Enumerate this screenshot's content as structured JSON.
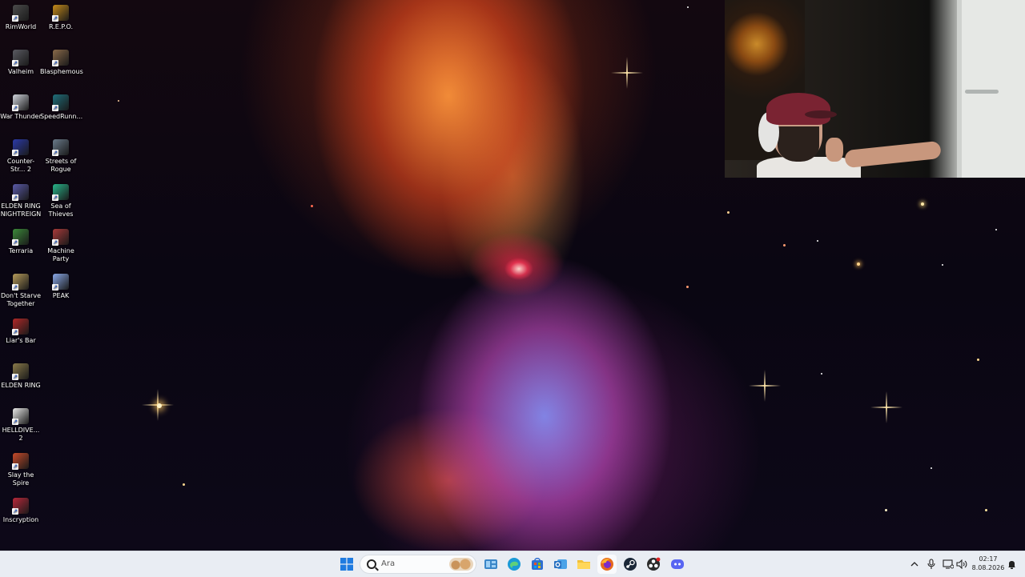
{
  "desktop": {
    "icons": [
      {
        "label": "RimWorld",
        "color": "#4b4b4b"
      },
      {
        "label": "R.E.P.O.",
        "color": "#c58a1a"
      },
      {
        "label": "Valheim",
        "color": "#5a5a62"
      },
      {
        "label": "Blasphemous",
        "color": "#8a6a4a"
      },
      {
        "label": "War Thunder",
        "color": "#d0d4dc"
      },
      {
        "label": "SpeedRunn...",
        "color": "#1f6e7a"
      },
      {
        "label": "Counter-Str... 2",
        "color": "#2b3aa8"
      },
      {
        "label": "Streets of Rogue",
        "color": "#6a7a8a"
      },
      {
        "label": "ELDEN RING NIGHTREIGN",
        "color": "#5a5aa8"
      },
      {
        "label": "Sea of Thieves",
        "color": "#28b48a"
      },
      {
        "label": "Terraria",
        "color": "#3c8a3a"
      },
      {
        "label": "Machine Party",
        "color": "#a83a3a"
      },
      {
        "label": "Don't Starve Together",
        "color": "#b59a5a"
      },
      {
        "label": "PEAK",
        "color": "#8aa8e8"
      },
      {
        "label": "Liar's Bar",
        "color": "#b02828"
      },
      {
        "label": "ELDEN RING",
        "color": "#8a7a4a"
      },
      {
        "label": "HELLDIVE... 2",
        "color": "#e8e8e8"
      },
      {
        "label": "Slay the Spire",
        "color": "#c84a2a"
      },
      {
        "label": "Inscryption",
        "color": "#b8283a"
      }
    ]
  },
  "taskbar": {
    "search_placeholder": "Ara",
    "apps": [
      {
        "name": "start-icon",
        "color": "#1f7be0"
      },
      {
        "name": "widgets-icon",
        "color": "#3a86c8"
      },
      {
        "name": "edge-icon",
        "color": "#1b9ad6"
      },
      {
        "name": "store-icon",
        "color": "#2f6fd0"
      },
      {
        "name": "outlook-icon",
        "color": "#2a72c2"
      },
      {
        "name": "file-explorer-icon",
        "color": "#f2c037"
      },
      {
        "name": "firefox-icon",
        "color": "#e66a1f"
      },
      {
        "name": "steam-icon",
        "color": "#1b2838"
      },
      {
        "name": "obs-icon",
        "color": "#2a2a2a"
      },
      {
        "name": "discord-icon",
        "color": "#5865f2"
      }
    ],
    "clock": {
      "time": "02:17",
      "date": "8.08.2026"
    }
  }
}
